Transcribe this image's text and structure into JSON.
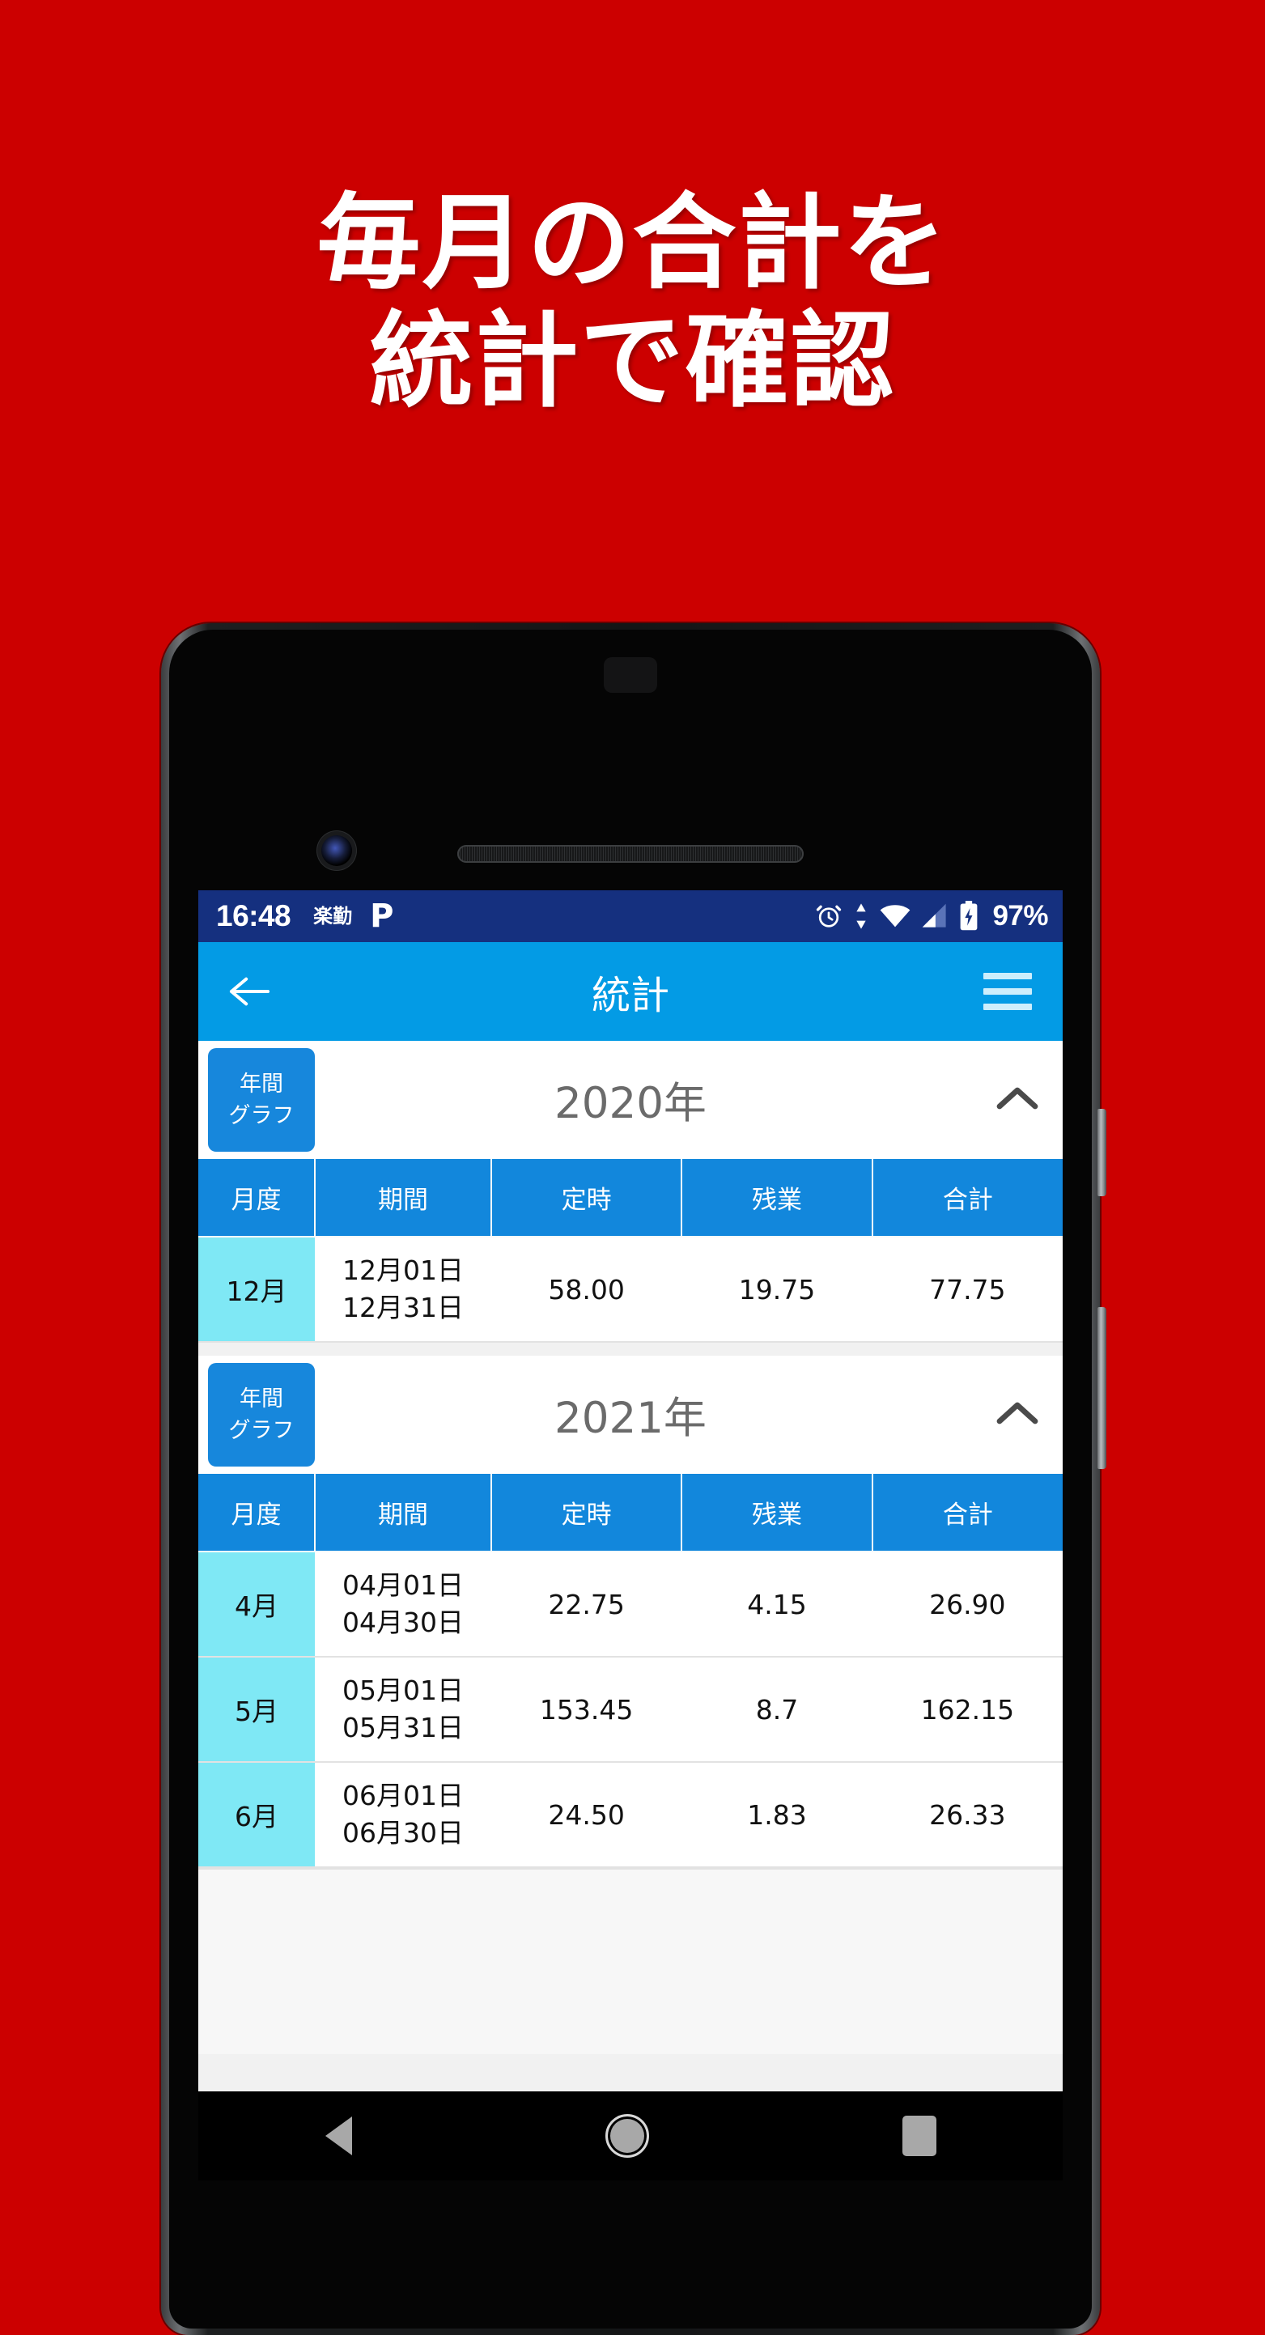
{
  "promo": {
    "line1": "毎月の合計を",
    "line2": "統計で確認",
    "background_color": "#cc0000",
    "text_color": "#ffffff"
  },
  "status_bar": {
    "time": "16:48",
    "app_notification_icon_label": "楽勤",
    "parking_icon_label": "P",
    "icons": [
      "alarm-icon",
      "data-transfer-icon",
      "wifi-icon",
      "signal-icon",
      "battery-charging-icon"
    ],
    "battery_percent": "97%",
    "background_color": "#15307f"
  },
  "app_bar": {
    "title": "統計",
    "back_icon": "arrow-left-icon",
    "menu_icon": "hamburger-menu-icon",
    "background_color": "#039be5"
  },
  "table": {
    "headers": [
      "月度",
      "期間",
      "定時",
      "残業",
      "合計"
    ],
    "header_background": "#1287dc",
    "month_cell_background": "#7fe8f5"
  },
  "graph_button": {
    "line1": "年間",
    "line2": "グラフ",
    "background_color": "#1787dc"
  },
  "sections": [
    {
      "year": "2020年",
      "collapse_icon": "chevron-up-icon",
      "rows": [
        {
          "month": "12月",
          "period_start": "12月01日",
          "period_end": "12月31日",
          "regular": "58.00",
          "overtime": "19.75",
          "total": "77.75"
        }
      ]
    },
    {
      "year": "2021年",
      "collapse_icon": "chevron-up-icon",
      "rows": [
        {
          "month": "4月",
          "period_start": "04月01日",
          "period_end": "04月30日",
          "regular": "22.75",
          "overtime": "4.15",
          "total": "26.90"
        },
        {
          "month": "5月",
          "period_start": "05月01日",
          "period_end": "05月31日",
          "regular": "153.45",
          "overtime": "8.7",
          "total": "162.15"
        },
        {
          "month": "6月",
          "period_start": "06月01日",
          "period_end": "06月30日",
          "regular": "24.50",
          "overtime": "1.83",
          "total": "26.33"
        }
      ]
    }
  ],
  "nav_bar": {
    "back_icon": "nav-back-triangle-icon",
    "home_icon": "nav-home-circle-icon",
    "recents_icon": "nav-recents-square-icon"
  }
}
